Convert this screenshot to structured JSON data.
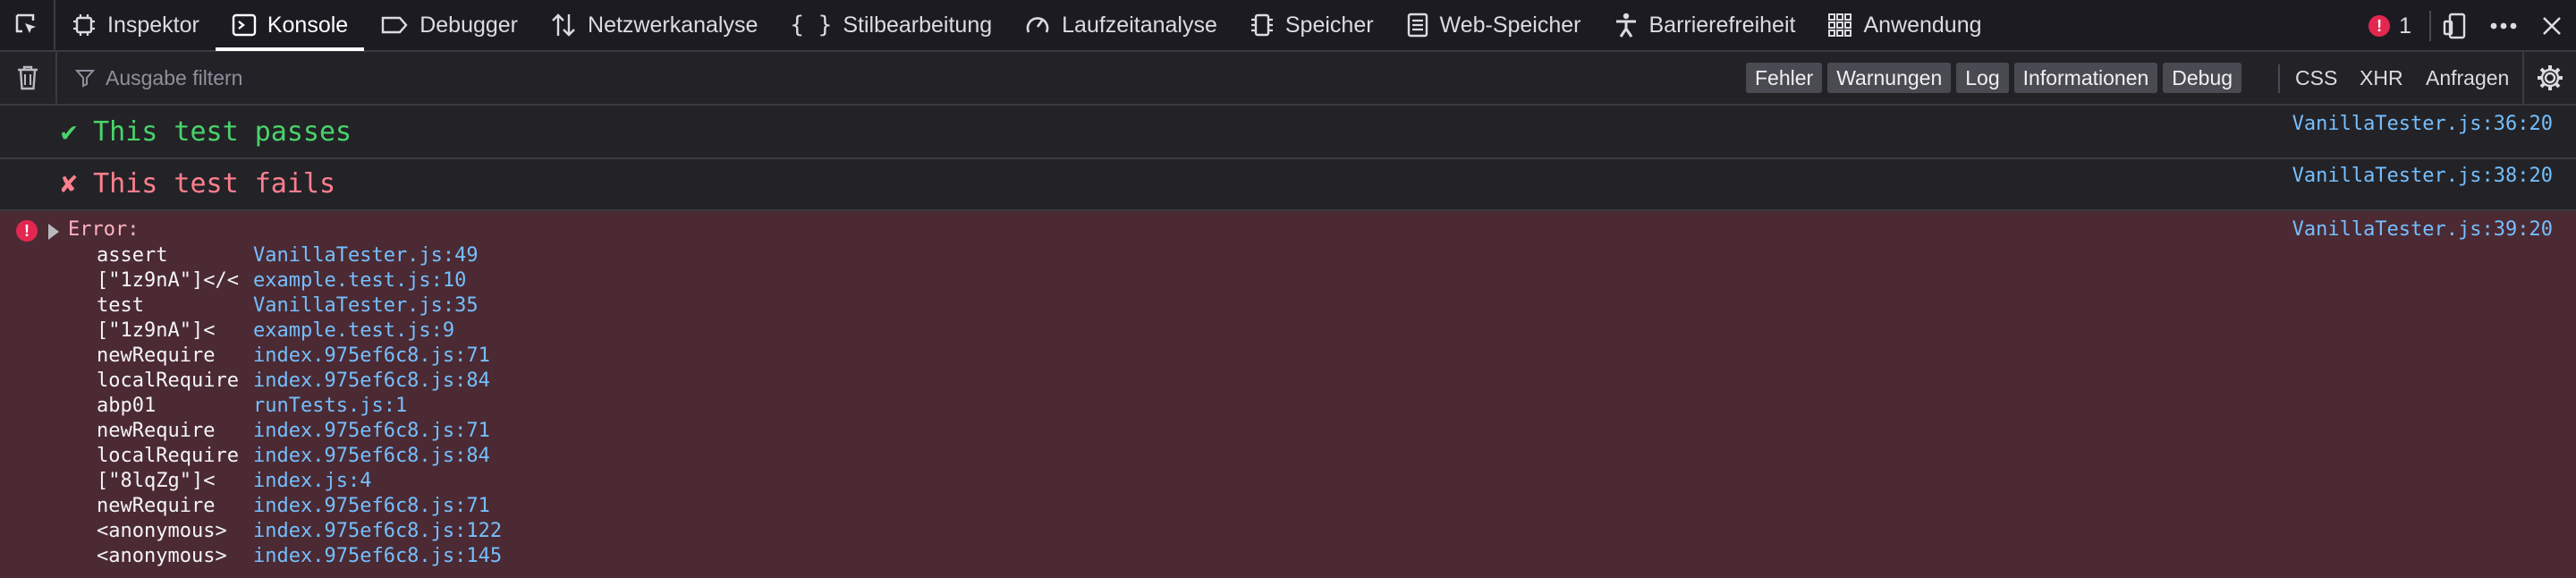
{
  "toolbar": {
    "tabs": [
      {
        "label": "Inspektor",
        "icon": "inspector-icon"
      },
      {
        "label": "Konsole",
        "icon": "console-icon"
      },
      {
        "label": "Debugger",
        "icon": "debugger-icon"
      },
      {
        "label": "Netzwerkanalyse",
        "icon": "network-icon"
      },
      {
        "label": "Stilbearbeitung",
        "icon": "style-editor-icon"
      },
      {
        "label": "Laufzeitanalyse",
        "icon": "performance-icon"
      },
      {
        "label": "Speicher",
        "icon": "memory-icon"
      },
      {
        "label": "Web-Speicher",
        "icon": "storage-icon"
      },
      {
        "label": "Barrierefreiheit",
        "icon": "accessibility-icon"
      },
      {
        "label": "Anwendung",
        "icon": "application-icon"
      }
    ],
    "active_tab": "Konsole",
    "error_count": "1"
  },
  "filterbar": {
    "placeholder": "Ausgabe filtern",
    "levels": [
      "Fehler",
      "Warnungen",
      "Log",
      "Informationen",
      "Debug"
    ],
    "requests": [
      "CSS",
      "XHR",
      "Anfragen"
    ]
  },
  "messages": {
    "pass": {
      "text": "✔ This test passes",
      "location": "VanillaTester.js:36:20"
    },
    "fail": {
      "text": "✘ This test fails",
      "location": "VanillaTester.js:38:20"
    },
    "error": {
      "head": "Error:",
      "location": "VanillaTester.js:39:20",
      "frames": [
        {
          "fn": "assert",
          "src": "VanillaTester.js:49"
        },
        {
          "fn": "[\"1z9nA\"]</<",
          "src": "example.test.js:10"
        },
        {
          "fn": "test",
          "src": "VanillaTester.js:35"
        },
        {
          "fn": "[\"1z9nA\"]<",
          "src": "example.test.js:9"
        },
        {
          "fn": "newRequire",
          "src": "index.975ef6c8.js:71"
        },
        {
          "fn": "localRequire",
          "src": "index.975ef6c8.js:84"
        },
        {
          "fn": "abp01",
          "src": "runTests.js:1"
        },
        {
          "fn": "newRequire",
          "src": "index.975ef6c8.js:71"
        },
        {
          "fn": "localRequire",
          "src": "index.975ef6c8.js:84"
        },
        {
          "fn": "[\"8lqZg\"]<",
          "src": "index.js:4"
        },
        {
          "fn": "newRequire",
          "src": "index.975ef6c8.js:71"
        },
        {
          "fn": "<anonymous>",
          "src": "index.975ef6c8.js:122"
        },
        {
          "fn": "<anonymous>",
          "src": "index.975ef6c8.js:145"
        }
      ]
    }
  }
}
